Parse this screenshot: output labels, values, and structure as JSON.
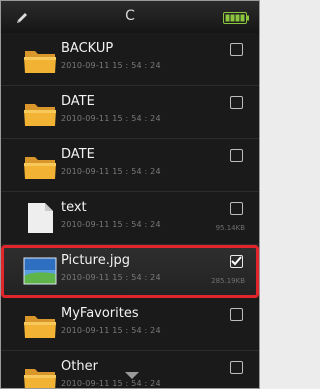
{
  "header": {
    "drive_label": "C",
    "edit_icon": "pencil-icon",
    "battery_icon": "battery-icon",
    "battery_color": "#8cc63f"
  },
  "files": [
    {
      "name": "BACKUP",
      "date": "2010-09-11 15 : 54 : 24",
      "size": "",
      "type": "folder",
      "checked": false
    },
    {
      "name": "DATE",
      "date": "2010-09-11 15 : 54 : 24",
      "size": "",
      "type": "folder",
      "checked": false
    },
    {
      "name": "DATE",
      "date": "2010-09-11 15 : 54 : 24",
      "size": "",
      "type": "folder",
      "checked": false
    },
    {
      "name": "text",
      "date": "2010-09-11 15 : 54 : 24",
      "size": "95.14KB",
      "type": "document",
      "checked": false
    },
    {
      "name": "Picture.jpg",
      "date": "2010-09-11 15 : 54 : 24",
      "size": "285.19KB",
      "type": "image",
      "checked": true
    },
    {
      "name": "MyFavorites",
      "date": "2010-09-11 15 : 54 : 24",
      "size": "",
      "type": "folder",
      "checked": false
    },
    {
      "name": "Other",
      "date": "2010-09-11 15 : 54 : 24",
      "size": "",
      "type": "folder",
      "checked": false
    }
  ],
  "colors": {
    "selection_outline": "#e0262b",
    "folder": "#f2b233"
  }
}
